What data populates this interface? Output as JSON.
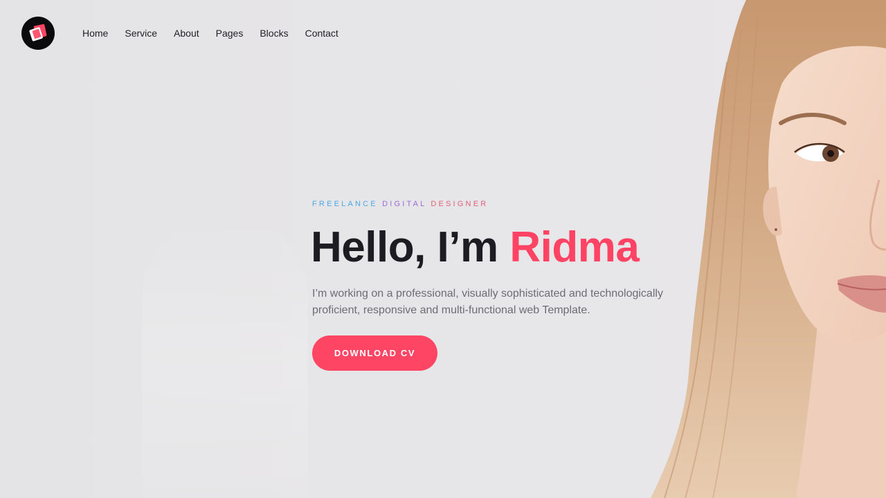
{
  "nav": {
    "items": [
      {
        "label": "Home"
      },
      {
        "label": "Service"
      },
      {
        "label": "About"
      },
      {
        "label": "Pages"
      },
      {
        "label": "Blocks"
      },
      {
        "label": "Contact"
      }
    ]
  },
  "hero": {
    "eyebrow": {
      "word1": "FREELANCE",
      "word2": "DIGITAL",
      "word3": "DESIGNER"
    },
    "headline": {
      "prefix": "Hello, I’m",
      "name": "Ridma"
    },
    "description": "I’m working on a professional, visually sophisticated and technologically proficient, responsive and multi-functional web Template.",
    "cta_label": "DOWNLOAD CV"
  },
  "colors": {
    "accent": "#fe4364",
    "eyebrow_blue": "#4aa8e6",
    "eyebrow_purple": "#9a6ad8",
    "eyebrow_pink": "#e1607c",
    "heading": "#1d1c22",
    "background": "#e6e5e7"
  },
  "icons": {
    "logo": "squares-logo-icon"
  }
}
